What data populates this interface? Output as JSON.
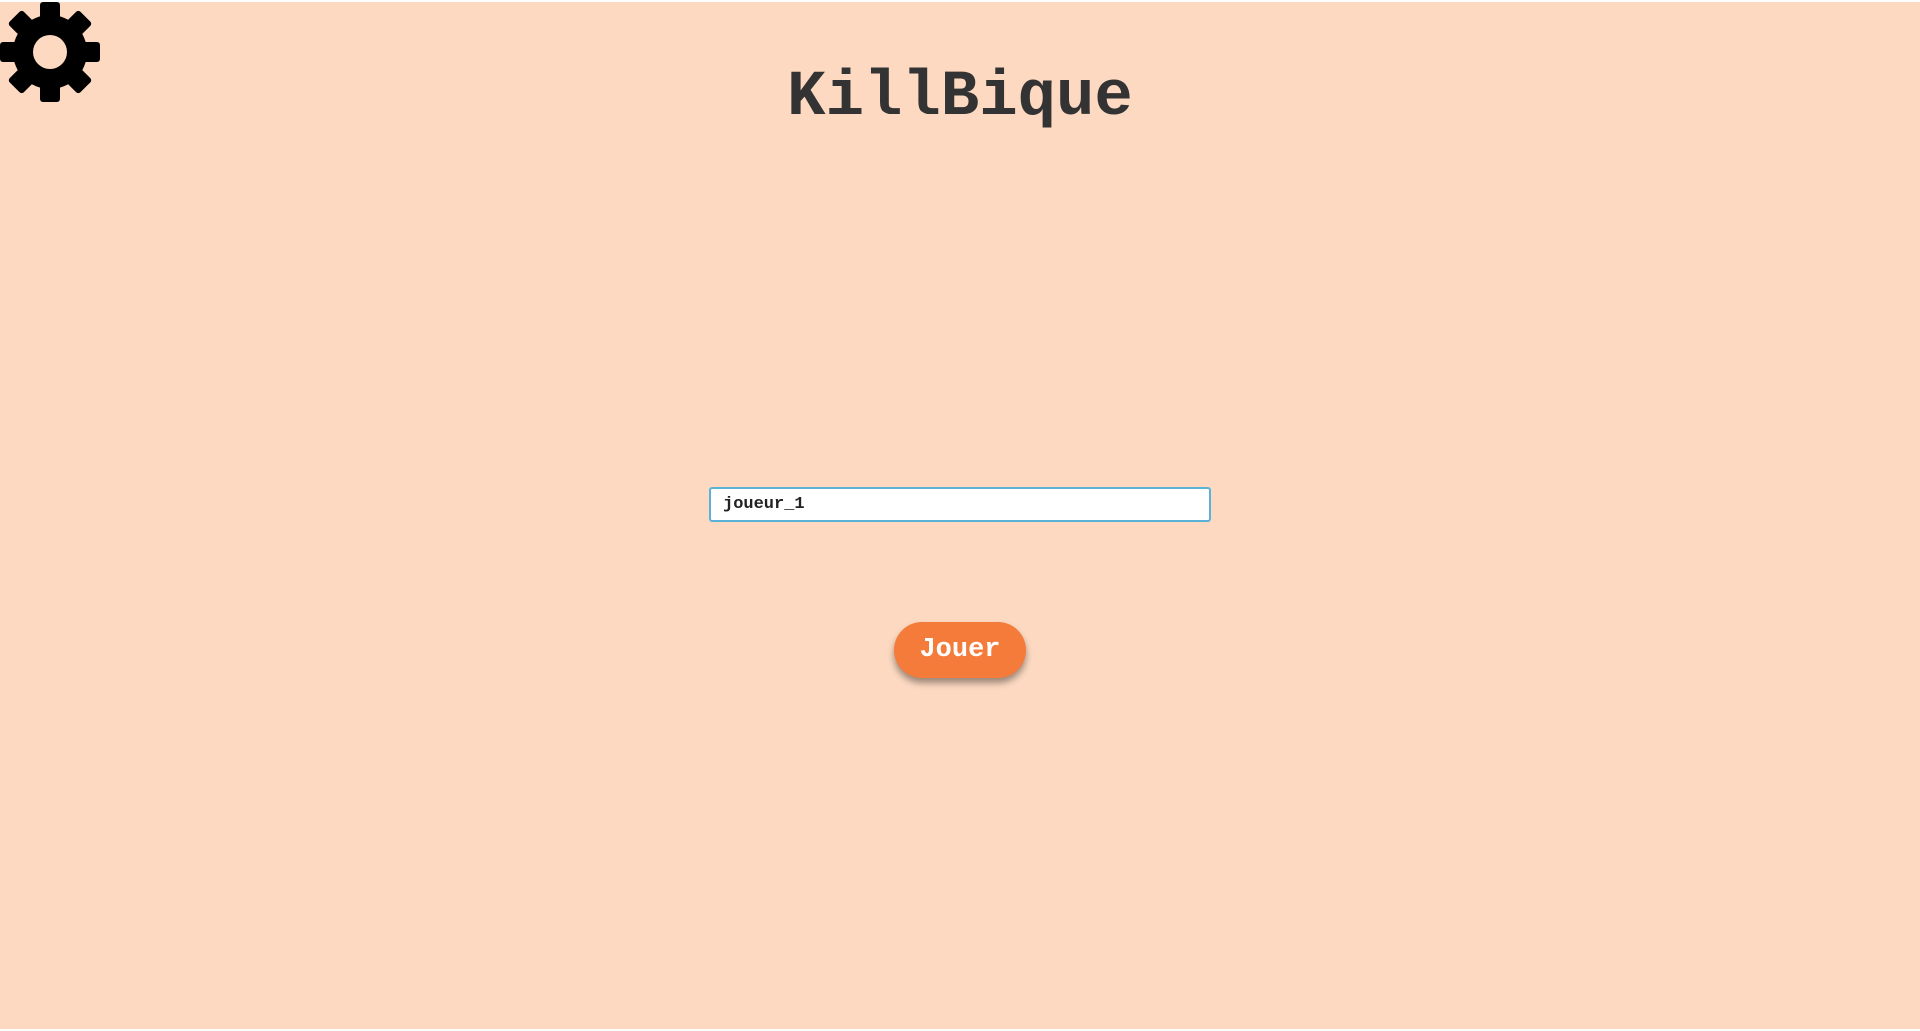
{
  "app": {
    "title": "KillBique",
    "background_color": "#fdd9c1"
  },
  "settings": {
    "icon": "gear-icon"
  },
  "login": {
    "username_value": "joueur_1",
    "play_label": "Jouer",
    "play_color": "#f47b3a",
    "input_border_color": "#5ab3d6"
  }
}
